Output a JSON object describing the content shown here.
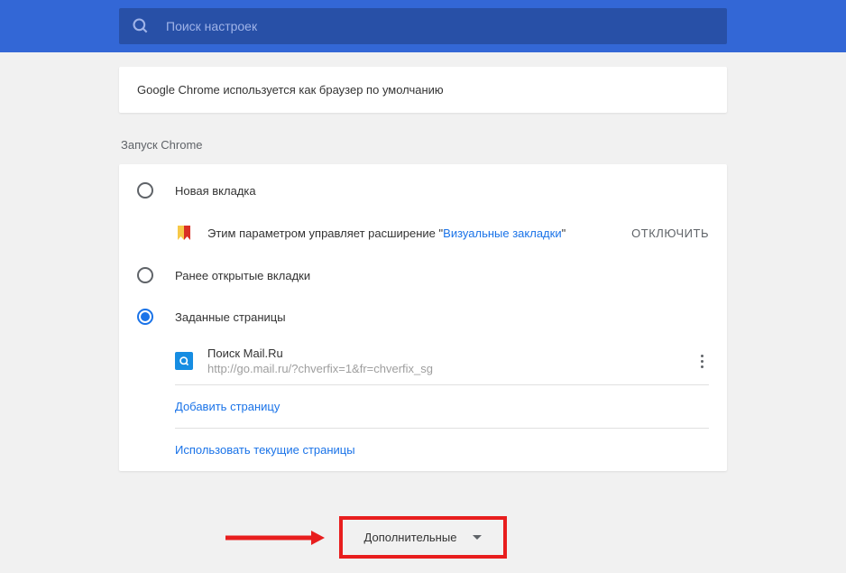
{
  "header": {
    "search_placeholder": "Поиск настроек"
  },
  "default_browser": {
    "message": "Google Chrome используется как браузер по умолчанию"
  },
  "startup": {
    "title": "Запуск Chrome",
    "options": {
      "new_tab": "Новая вкладка",
      "continue": "Ранее открытые вкладки",
      "specific": "Заданные страницы"
    },
    "extension_notice": {
      "prefix": "Этим параметром управляет расширение \"",
      "link": "Визуальные закладки",
      "suffix": "\"",
      "action": "ОТКЛЮЧИТЬ"
    },
    "pages": [
      {
        "name": "Поиск Mail.Ru",
        "url": "http://go.mail.ru/?chverfix=1&fr=chverfix_sg"
      }
    ],
    "add_page": "Добавить страницу",
    "use_current": "Использовать текущие страницы"
  },
  "expand": {
    "label": "Дополнительные"
  }
}
